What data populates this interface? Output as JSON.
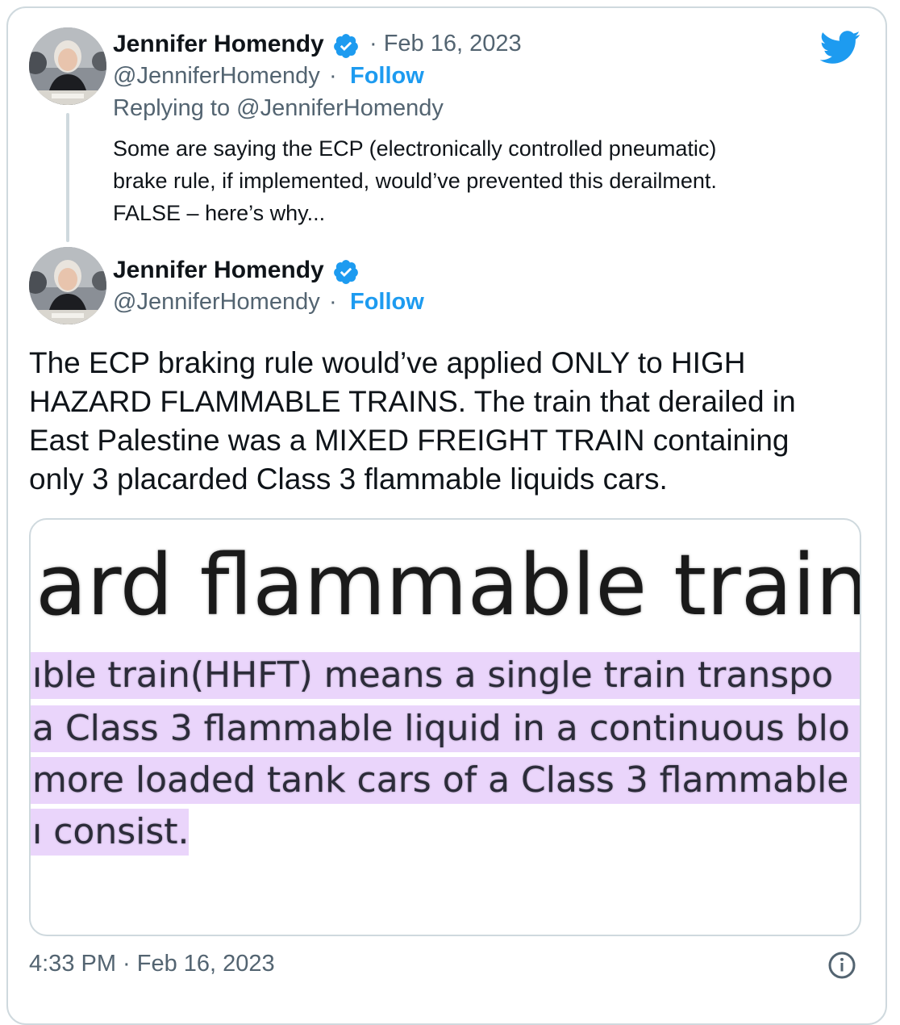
{
  "colors": {
    "twitter_blue": "#1d9bf0",
    "text_primary": "#0f1419",
    "text_secondary": "#536471",
    "border": "#cfd9de",
    "highlight": "#ead5fb"
  },
  "header": {
    "logo_icon": "twitter-bird-icon"
  },
  "reply_tweet": {
    "author_name": "Jennifer Homendy",
    "date": "· Feb 16, 2023",
    "handle": "@JenniferHomendy",
    "separator": " · ",
    "follow_label": "Follow",
    "replying_to": "Replying to @JenniferHomendy",
    "text_lines": [
      "Some are saying the ECP (electronically controlled pneumatic)",
      "brake rule, if implemented, would’ve prevented this derailment.",
      "FALSE – here’s why..."
    ]
  },
  "main_tweet": {
    "author_name": "Jennifer Homendy",
    "handle": "@JenniferHomendy",
    "separator": " · ",
    "follow_label": "Follow",
    "text_lines": [
      "The ECP braking rule would’ve applied ONLY to HIGH",
      "HAZARD FLAMMABLE TRAINS. The train that derailed in",
      "East Palestine was a MIXED FREIGHT TRAIN containing",
      "only 3 placarded Class 3 flammable liquids cars."
    ],
    "media": {
      "title_fragment": "ard flammable train",
      "highlighted_lines": [
        "ıble train(HHFT) means a single train transpo",
        "a Class 3 flammable liquid in a continuous blo",
        "more loaded tank cars of a Class 3 flammable",
        "ı consist."
      ]
    },
    "timestamp": "4:33 PM · Feb 16, 2023",
    "info_icon": "info-icon"
  }
}
